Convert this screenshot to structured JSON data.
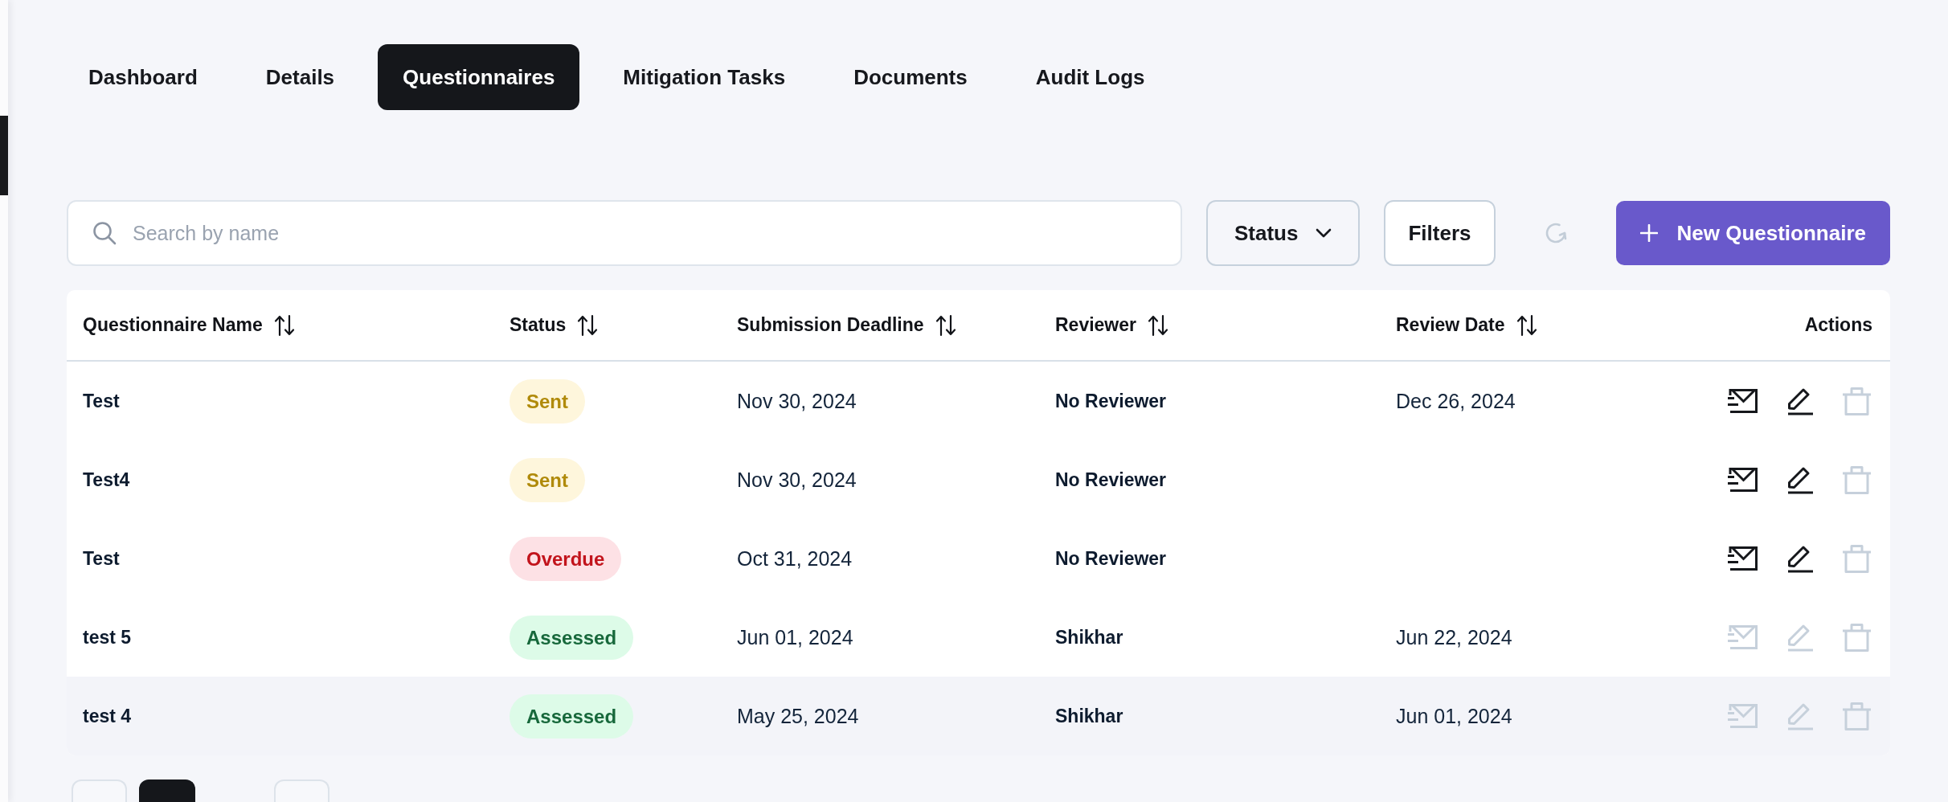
{
  "tabs": [
    {
      "label": "Dashboard",
      "selected": false
    },
    {
      "label": "Details",
      "selected": false
    },
    {
      "label": "Questionnaires",
      "selected": true
    },
    {
      "label": "Mitigation Tasks",
      "selected": false
    },
    {
      "label": "Documents",
      "selected": false
    },
    {
      "label": "Audit Logs",
      "selected": false
    }
  ],
  "toolbar": {
    "search": {
      "placeholder": "Search by name"
    },
    "status_dropdown": {
      "label": "Status"
    },
    "filters_button": {
      "label": "Filters"
    },
    "new_button": {
      "label": "New Questionnaire"
    }
  },
  "table": {
    "columns": [
      {
        "label": "Questionnaire Name",
        "sortable": true
      },
      {
        "label": "Status",
        "sortable": true
      },
      {
        "label": "Submission Deadline",
        "sortable": true
      },
      {
        "label": "Reviewer",
        "sortable": true
      },
      {
        "label": "Review Date",
        "sortable": true
      },
      {
        "label": "Actions",
        "sortable": false
      }
    ],
    "rows": [
      {
        "name": "Test",
        "status": {
          "label": "Sent",
          "kind": "sent"
        },
        "deadline": "Nov 30, 2024",
        "reviewer": "No Reviewer",
        "review_date": "Dec 26, 2024",
        "highlighted": false,
        "actions": [
          {
            "kind": "send",
            "disabled": false
          },
          {
            "kind": "edit",
            "disabled": false
          },
          {
            "kind": "delete",
            "disabled": true
          }
        ]
      },
      {
        "name": "Test4",
        "status": {
          "label": "Sent",
          "kind": "sent"
        },
        "deadline": "Nov 30, 2024",
        "reviewer": "No Reviewer",
        "highlighted": false,
        "actions": [
          {
            "kind": "send",
            "disabled": false
          },
          {
            "kind": "edit",
            "disabled": false
          },
          {
            "kind": "delete",
            "disabled": true
          }
        ]
      },
      {
        "name": "Test",
        "status": {
          "label": "Overdue",
          "kind": "overdue"
        },
        "deadline": "Oct 31, 2024",
        "reviewer": "No Reviewer",
        "highlighted": false,
        "actions": [
          {
            "kind": "send",
            "disabled": false
          },
          {
            "kind": "edit",
            "disabled": false
          },
          {
            "kind": "delete",
            "disabled": true
          }
        ]
      },
      {
        "name": "test 5",
        "status": {
          "label": "Assessed",
          "kind": "assessed"
        },
        "deadline": "Jun 01, 2024",
        "reviewer": "Shikhar",
        "review_date": "Jun 22, 2024",
        "highlighted": false,
        "actions": [
          {
            "kind": "send",
            "disabled": true
          },
          {
            "kind": "edit",
            "disabled": true
          },
          {
            "kind": "delete",
            "disabled": true
          }
        ]
      },
      {
        "name": "test 4",
        "status": {
          "label": "Assessed",
          "kind": "assessed"
        },
        "deadline": "May 25, 2024",
        "reviewer": "Shikhar",
        "review_date": "Jun 01, 2024",
        "highlighted": true,
        "actions": [
          {
            "kind": "send",
            "disabled": true
          },
          {
            "kind": "edit",
            "disabled": true
          },
          {
            "kind": "delete",
            "disabled": true
          }
        ]
      }
    ]
  },
  "pagination": {
    "pages": [
      {
        "selected": true
      }
    ]
  }
}
